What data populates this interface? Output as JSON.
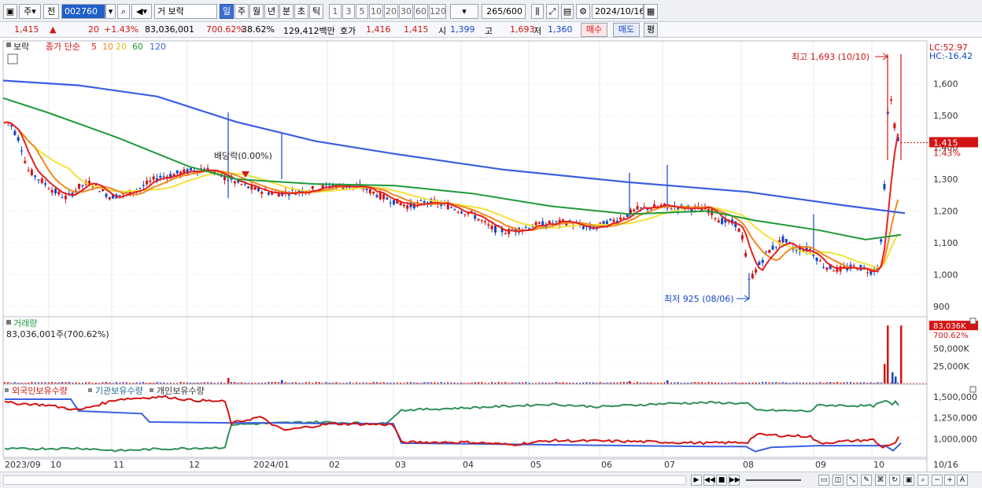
{
  "toolbar": {
    "market": "주",
    "prev_label": "전",
    "code": "002760",
    "stock_name": "보락",
    "period_tabs": [
      "일",
      "주",
      "월",
      "년",
      "분",
      "초",
      "틱"
    ],
    "nums": [
      "1",
      "3",
      "5",
      "10",
      "20",
      "30",
      "60",
      "120"
    ],
    "count": "265",
    "count_total": "/600",
    "date": "2024/10/16"
  },
  "quote": {
    "price": "1,415",
    "arrow": "▲",
    "change": "20",
    "rate": "+1.43%",
    "volume": "83,036,001",
    "vol_ratio": "700.62%",
    "turnover": "38.62%",
    "amount": "129,412백만",
    "hoga_label": "호가",
    "hoga": "1,416",
    "hoga2": "1,415",
    "open_label": "시",
    "open": "1,399",
    "high_label": "고",
    "high": "1,693",
    "low_label": "저",
    "low": "1,360",
    "buy": "매수",
    "sell": "매도",
    "avg": "평"
  },
  "price_pane": {
    "legend_name": "보락",
    "ma_label": "종가 단순",
    "ma_periods": [
      "5",
      "10",
      "20",
      "60",
      "120"
    ],
    "lc": "LC:52.97",
    "hc": "HC:-16.42",
    "y_ticks": [
      "1,600",
      "1,500",
      "1,400",
      "1,300",
      "1,200",
      "1,100",
      "1,000",
      "900"
    ],
    "current_price": "1,415",
    "current_rate": "1.43%",
    "high_annot": "최고 1,693 (10/10)",
    "low_annot": "최저 925 (08/06)",
    "dividend_annot": "배당락(0.00%)"
  },
  "volume_pane": {
    "title": "거래량",
    "value": "83,036,001주(700.62%)",
    "last_tag": "83,036K",
    "last_rate": "700.62%",
    "y_ticks": [
      "50,000K",
      "25,000K"
    ]
  },
  "holding_pane": {
    "legend": [
      "외국인보유수량",
      "기관보유수량",
      "개인보유수량"
    ],
    "y_ticks": [
      "1,500,000",
      "1,250,000",
      "1,000,000"
    ]
  },
  "x_axis": {
    "labels": [
      "2023/09",
      "10",
      "11",
      "12",
      "2024/01",
      "02",
      "03",
      "04",
      "05",
      "06",
      "07",
      "08",
      "09",
      "10"
    ],
    "right": "10/16"
  },
  "colors": {
    "up": "#d31414",
    "down": "#1445c8",
    "ma5": "#e62020",
    "ma10": "#f08a1c",
    "ma20": "#f2e23a",
    "ma60": "#1f9a3a",
    "ma120": "#3a5fe0"
  },
  "chart_data": [
    {
      "type": "line",
      "title": "보락",
      "ylim": [
        880,
        1720
      ],
      "x": [
        "2023/09",
        "2023/10",
        "2023/11",
        "2023/12",
        "2024/01",
        "2024/02",
        "2024/03",
        "2024/04",
        "2024/05",
        "2024/06",
        "2024/07",
        "2024/08",
        "2024/09",
        "2024/10",
        "2024/10/16"
      ],
      "series": [
        {
          "name": "종가",
          "values": [
            1470,
            1300,
            1250,
            1270,
            1320,
            1270,
            1230,
            1130,
            1150,
            1170,
            1200,
            1090,
            1050,
            1020,
            1415
          ]
        },
        {
          "name": "5",
          "values": [
            1470,
            1310,
            1250,
            1265,
            1320,
            1275,
            1230,
            1135,
            1155,
            1175,
            1205,
            1100,
            1060,
            1030,
            1450
          ]
        },
        {
          "name": "120",
          "values": [
            1610,
            1520,
            1420,
            1370,
            1320,
            1300,
            1270,
            1240,
            1220,
            1200,
            1190,
            1180,
            1160,
            1130,
            1140
          ]
        }
      ],
      "annotations": [
        "최고 1,693 (10/10)",
        "최저 925 (08/06)",
        "배당락(0.00%)"
      ]
    },
    {
      "type": "bar",
      "title": "거래량",
      "ylim": [
        0,
        90000
      ],
      "series": [
        {
          "name": "거래량",
          "values": [
            3000,
            5000,
            4000,
            8000,
            2000,
            3000,
            2500,
            2000,
            3000,
            4000,
            4500,
            3000,
            3500,
            83036
          ]
        }
      ]
    },
    {
      "type": "line",
      "ylim": [
        800000,
        1600000
      ],
      "series": [
        {
          "name": "외국인보유수량",
          "values": [
            1420000,
            1310000,
            1470000,
            1450000,
            1200000,
            1140000,
            960000,
            930000,
            970000,
            940000,
            950000,
            990000,
            920000,
            1100000
          ]
        },
        {
          "name": "기관보유수량",
          "values": [
            1460000,
            1300000,
            1200000,
            1190000,
            1180000,
            1170000,
            930000,
            920000,
            900000,
            910000,
            900000,
            860000,
            920000,
            930000
          ]
        },
        {
          "name": "개인보유수량",
          "values": [
            880000,
            880000,
            880000,
            900000,
            1150000,
            1180000,
            1350000,
            1390000,
            1400000,
            1380000,
            1420000,
            1420000,
            1360000,
            1300000
          ]
        }
      ]
    }
  ]
}
